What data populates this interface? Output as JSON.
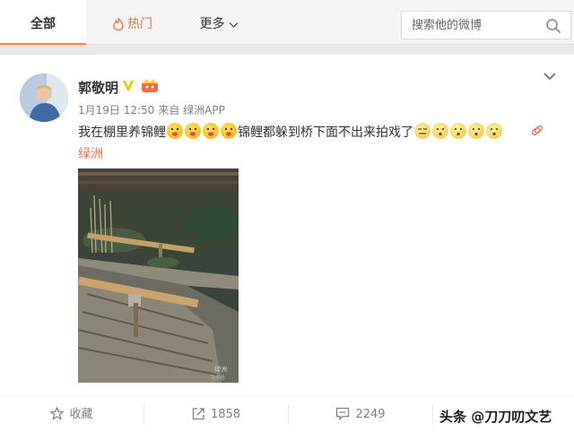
{
  "tabs": {
    "all": "全部",
    "hot": "热门",
    "more": "更多"
  },
  "search": {
    "placeholder": "搜索他的微博"
  },
  "post": {
    "username": "郭敬明",
    "date": "1月19日 12:50",
    "source": "来自 绿洲APP",
    "text_part1": "我在棚里养锦鲤",
    "text_part2": "锦鲤都躲到桥下面不出来拍戏了",
    "topic": "绿洲",
    "photo_caption_line1": "绿洲",
    "photo_caption_line2": "孔多拍"
  },
  "actions": {
    "favorite": "收藏",
    "share_count": "1858",
    "comment_count": "2249"
  },
  "watermark": "头条 @刀刀叨文艺",
  "colors": {
    "accent": "#eb7350",
    "tab_underline": "#fa7d3c",
    "verified": "#f5c300"
  }
}
